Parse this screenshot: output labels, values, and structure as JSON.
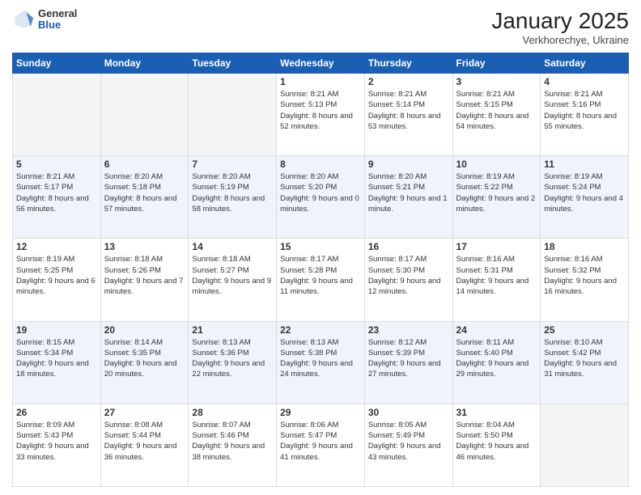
{
  "header": {
    "logo_general": "General",
    "logo_blue": "Blue",
    "month_title": "January 2025",
    "subtitle": "Verkhorechye, Ukraine"
  },
  "days_of_week": [
    "Sunday",
    "Monday",
    "Tuesday",
    "Wednesday",
    "Thursday",
    "Friday",
    "Saturday"
  ],
  "weeks": [
    [
      {
        "day": "",
        "info": ""
      },
      {
        "day": "",
        "info": ""
      },
      {
        "day": "",
        "info": ""
      },
      {
        "day": "1",
        "info": "Sunrise: 8:21 AM\nSunset: 5:13 PM\nDaylight: 8 hours\nand 52 minutes."
      },
      {
        "day": "2",
        "info": "Sunrise: 8:21 AM\nSunset: 5:14 PM\nDaylight: 8 hours\nand 53 minutes."
      },
      {
        "day": "3",
        "info": "Sunrise: 8:21 AM\nSunset: 5:15 PM\nDaylight: 8 hours\nand 54 minutes."
      },
      {
        "day": "4",
        "info": "Sunrise: 8:21 AM\nSunset: 5:16 PM\nDaylight: 8 hours\nand 55 minutes."
      }
    ],
    [
      {
        "day": "5",
        "info": "Sunrise: 8:21 AM\nSunset: 5:17 PM\nDaylight: 8 hours\nand 56 minutes."
      },
      {
        "day": "6",
        "info": "Sunrise: 8:20 AM\nSunset: 5:18 PM\nDaylight: 8 hours\nand 57 minutes."
      },
      {
        "day": "7",
        "info": "Sunrise: 8:20 AM\nSunset: 5:19 PM\nDaylight: 8 hours\nand 58 minutes."
      },
      {
        "day": "8",
        "info": "Sunrise: 8:20 AM\nSunset: 5:20 PM\nDaylight: 9 hours\nand 0 minutes."
      },
      {
        "day": "9",
        "info": "Sunrise: 8:20 AM\nSunset: 5:21 PM\nDaylight: 9 hours\nand 1 minute."
      },
      {
        "day": "10",
        "info": "Sunrise: 8:19 AM\nSunset: 5:22 PM\nDaylight: 9 hours\nand 2 minutes."
      },
      {
        "day": "11",
        "info": "Sunrise: 8:19 AM\nSunset: 5:24 PM\nDaylight: 9 hours\nand 4 minutes."
      }
    ],
    [
      {
        "day": "12",
        "info": "Sunrise: 8:19 AM\nSunset: 5:25 PM\nDaylight: 9 hours\nand 6 minutes."
      },
      {
        "day": "13",
        "info": "Sunrise: 8:18 AM\nSunset: 5:26 PM\nDaylight: 9 hours\nand 7 minutes."
      },
      {
        "day": "14",
        "info": "Sunrise: 8:18 AM\nSunset: 5:27 PM\nDaylight: 9 hours\nand 9 minutes."
      },
      {
        "day": "15",
        "info": "Sunrise: 8:17 AM\nSunset: 5:28 PM\nDaylight: 9 hours\nand 11 minutes."
      },
      {
        "day": "16",
        "info": "Sunrise: 8:17 AM\nSunset: 5:30 PM\nDaylight: 9 hours\nand 12 minutes."
      },
      {
        "day": "17",
        "info": "Sunrise: 8:16 AM\nSunset: 5:31 PM\nDaylight: 9 hours\nand 14 minutes."
      },
      {
        "day": "18",
        "info": "Sunrise: 8:16 AM\nSunset: 5:32 PM\nDaylight: 9 hours\nand 16 minutes."
      }
    ],
    [
      {
        "day": "19",
        "info": "Sunrise: 8:15 AM\nSunset: 5:34 PM\nDaylight: 9 hours\nand 18 minutes."
      },
      {
        "day": "20",
        "info": "Sunrise: 8:14 AM\nSunset: 5:35 PM\nDaylight: 9 hours\nand 20 minutes."
      },
      {
        "day": "21",
        "info": "Sunrise: 8:13 AM\nSunset: 5:36 PM\nDaylight: 9 hours\nand 22 minutes."
      },
      {
        "day": "22",
        "info": "Sunrise: 8:13 AM\nSunset: 5:38 PM\nDaylight: 9 hours\nand 24 minutes."
      },
      {
        "day": "23",
        "info": "Sunrise: 8:12 AM\nSunset: 5:39 PM\nDaylight: 9 hours\nand 27 minutes."
      },
      {
        "day": "24",
        "info": "Sunrise: 8:11 AM\nSunset: 5:40 PM\nDaylight: 9 hours\nand 29 minutes."
      },
      {
        "day": "25",
        "info": "Sunrise: 8:10 AM\nSunset: 5:42 PM\nDaylight: 9 hours\nand 31 minutes."
      }
    ],
    [
      {
        "day": "26",
        "info": "Sunrise: 8:09 AM\nSunset: 5:43 PM\nDaylight: 9 hours\nand 33 minutes."
      },
      {
        "day": "27",
        "info": "Sunrise: 8:08 AM\nSunset: 5:44 PM\nDaylight: 9 hours\nand 36 minutes."
      },
      {
        "day": "28",
        "info": "Sunrise: 8:07 AM\nSunset: 5:46 PM\nDaylight: 9 hours\nand 38 minutes."
      },
      {
        "day": "29",
        "info": "Sunrise: 8:06 AM\nSunset: 5:47 PM\nDaylight: 9 hours\nand 41 minutes."
      },
      {
        "day": "30",
        "info": "Sunrise: 8:05 AM\nSunset: 5:49 PM\nDaylight: 9 hours\nand 43 minutes."
      },
      {
        "day": "31",
        "info": "Sunrise: 8:04 AM\nSunset: 5:50 PM\nDaylight: 9 hours\nand 46 minutes."
      },
      {
        "day": "",
        "info": ""
      }
    ]
  ]
}
